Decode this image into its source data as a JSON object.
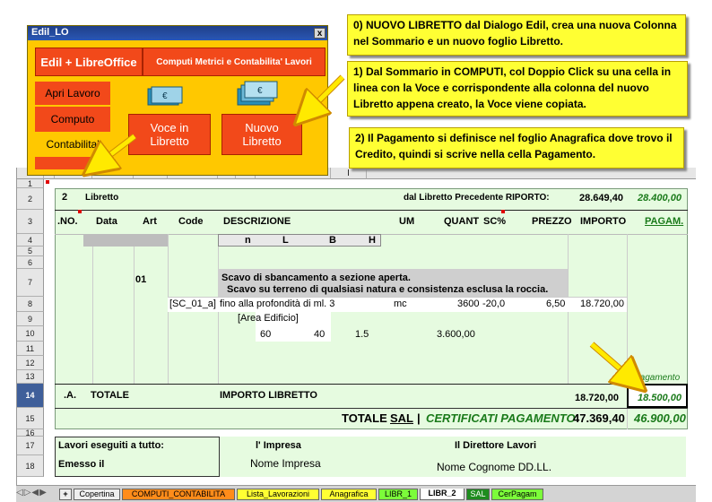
{
  "dialog": {
    "title": "Edil_LO",
    "close": "x",
    "header_left": "Edil + LibreOffice",
    "header_right": "Computi Metrici e Contabilita' Lavori",
    "menu": [
      "Apri Lavoro",
      "Computo",
      "Contabilita'"
    ],
    "voce_libretto": "Voce in Libretto",
    "nuovo_libretto": "Nuovo Libretto"
  },
  "callouts": {
    "c0": "0) NUOVO LIBRETTO dal Dialogo Edil, crea una nuova Colonna nel Sommario e un nuovo foglio Libretto.",
    "c1": "1) Dal Sommario in COMPUTI, col Doppio Click su una cella in linea con la Voce e corrispondente alla colonna del nuovo Libretto appena creato, la Voce viene copiata.",
    "c2": "2) Il Pagamento si definisce nel foglio Anagrafica dove trovo il Credito, quindi si scrive nella cella Pagamento."
  },
  "sheet": {
    "columns": [
      "A",
      "B",
      "C",
      "D",
      "E",
      "F",
      "G",
      "H",
      "I"
    ],
    "rows": [
      "1",
      "2",
      "3",
      "4",
      "5",
      "6",
      "7",
      "8",
      "9",
      "10",
      "11",
      "12",
      "13",
      "14",
      "15",
      "16",
      "17",
      "18"
    ],
    "r2": {
      "num": "2",
      "libretto": "Libretto",
      "riporto_label": "dal Libretto Precedente RIPORTO:",
      "riporto": "28.649,40",
      "riporto_pag": "28.400,00"
    },
    "headers": {
      "no": ".NO.",
      "data": "Data",
      "art": "Art",
      "code": "Code",
      "descr": "DESCRIZIONE",
      "um": "UM",
      "quant": "QUANT",
      "sc": "SC%",
      "prezzo": "PREZZO",
      "importo": "IMPORTO",
      "pagam": "PAGAM."
    },
    "sub": {
      "n": "n",
      "l": "L",
      "b": "B",
      "h": "H"
    },
    "r7": {
      "art": "01",
      "line1": "Scavo di sbancamento a sezione aperta.",
      "line2": "Scavo su terreno di qualsiasi natura e consistenza esclusa la roccia."
    },
    "r8": {
      "code": "[SC_01_a]",
      "descr": "fino alla profondità di ml. 3",
      "um": "mc",
      "quant": "3600",
      "sc": "-20,0",
      "prezzo": "6,50",
      "importo": "18.720,00"
    },
    "r9": {
      "descr": "[Area Edificio]"
    },
    "r10": {
      "l": "60",
      "b": "40",
      "h": "1.5",
      "quant": "3.600,00"
    },
    "r13": {
      "pagamento": "Pagamento"
    },
    "r14": {
      "no": ".A.",
      "totale": "TOTALE",
      "importo_label": "IMPORTO LIBRETTO",
      "importo": "18.720,00",
      "pagam": "18.500,00"
    },
    "r15": {
      "totale": "TOTALE",
      "sal": "SAL",
      "sep": "|",
      "cert": "CERTIFICATI PAGAMENTO",
      "importo": "47.369,40",
      "pagam": "46.900,00"
    },
    "r17": {
      "lavori": "Lavori eseguiti a tutto:",
      "impresa": "l' Impresa",
      "direttore": "Il Direttore Lavori"
    },
    "r18": {
      "emesso": "Emesso il",
      "nome_impresa": "Nome Impresa",
      "nome_dl": "Nome Cognome DD.LL."
    }
  },
  "tabs": [
    "+",
    "Copertina",
    "COMPUTI_CONTABILITA",
    "Lista_Lavorazioni",
    "Anagrafica",
    "LIBR_1",
    "LIBR_2",
    "SAL",
    "CerPagam"
  ],
  "colors": {
    "dialog_bg": "#ffc800",
    "button_red": "#f2491a",
    "callout": "#ffff33",
    "sheet_green": "#e6fbe0",
    "selected_row": "#3f5f9a"
  }
}
